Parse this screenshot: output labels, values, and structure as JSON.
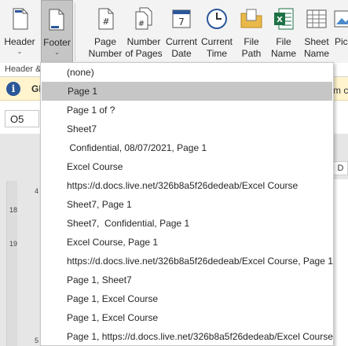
{
  "ribbon": {
    "buttons": [
      {
        "id": "header",
        "label": "Header",
        "icon": "header-icon",
        "has_dropdown": true
      },
      {
        "id": "footer",
        "label": "Footer",
        "icon": "footer-icon",
        "has_dropdown": true,
        "active": true
      },
      {
        "id": "page-number",
        "label": "Page Number",
        "line1": "Page",
        "line2": "Number",
        "icon": "page-number-icon"
      },
      {
        "id": "number-of-pages",
        "label": "Number of Pages",
        "line1": "Number",
        "line2": "of Pages",
        "icon": "number-of-pages-icon"
      },
      {
        "id": "current-date",
        "label": "Current Date",
        "line1": "Current",
        "line2": "Date",
        "icon": "calendar-icon"
      },
      {
        "id": "current-time",
        "label": "Current Time",
        "line1": "Current",
        "line2": "Time",
        "icon": "clock-icon"
      },
      {
        "id": "file-path",
        "label": "File Path",
        "line1": "File",
        "line2": "Path",
        "icon": "folder-icon"
      },
      {
        "id": "file-name",
        "label": "File Name",
        "line1": "File",
        "line2": "Name",
        "icon": "excel-file-icon"
      },
      {
        "id": "sheet-name",
        "label": "Sheet Name",
        "line1": "Sheet",
        "line2": "Name",
        "icon": "sheet-icon"
      },
      {
        "id": "picture",
        "label": "Pic",
        "icon": "picture-icon"
      }
    ],
    "group_label": "Header &"
  },
  "infobar": {
    "text": "GE",
    "right_text": "m c"
  },
  "namebox": {
    "value": "O5"
  },
  "sheet": {
    "column_letter": "D",
    "ruler_marks": [
      "4",
      "18",
      "19",
      "5"
    ]
  },
  "footer_menu": {
    "items": [
      "(none)",
      "Page 1",
      "Page 1 of ?",
      "Sheet7",
      " Confidential, 08/07/2021, Page 1",
      "Excel Course",
      "https://d.docs.live.net/326b8a5f26dedeab/Excel Course",
      "Sheet7, Page 1",
      "Sheet7,  Confidential, Page 1",
      "Excel Course, Page 1",
      "https://d.docs.live.net/326b8a5f26dedeab/Excel Course, Page 1",
      "Page 1, Sheet7",
      "Page 1, Excel Course",
      "Page 1, Excel Course",
      "Page 1, https://d.docs.live.net/326b8a5f26dedeab/Excel Course"
    ],
    "selected_index": 1
  },
  "colors": {
    "ribbon_bg": "#f3f3f3",
    "active_button_bg": "#c5c5c5",
    "selected_item_bg": "#c6c6c6",
    "infobar_bg": "#fff4ce",
    "excel_green": "#1e7145",
    "accent_blue": "#2b579a"
  }
}
